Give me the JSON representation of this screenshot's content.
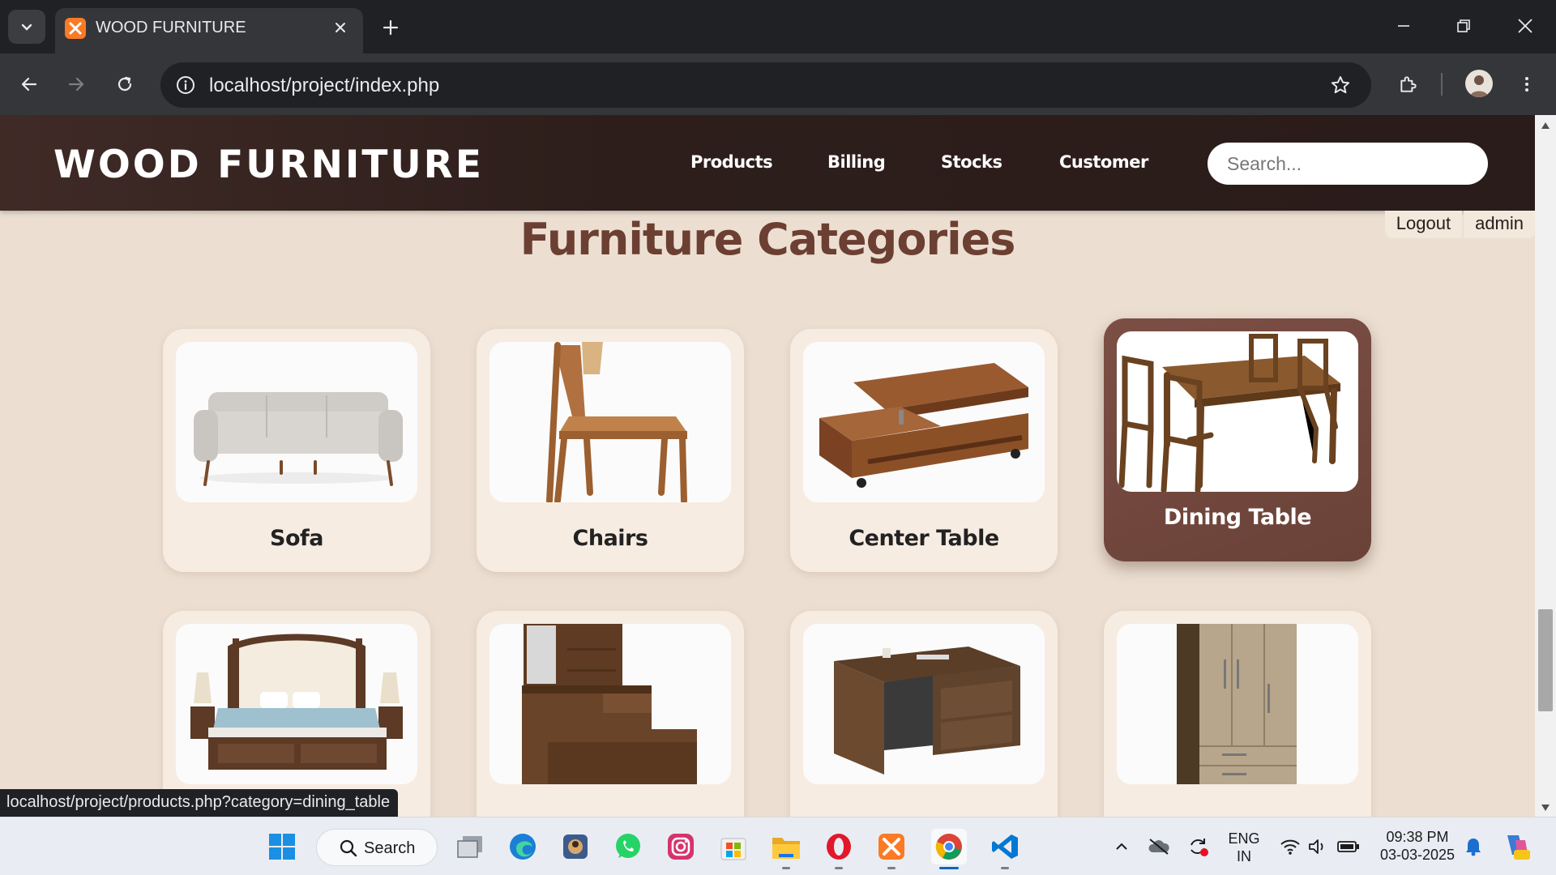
{
  "browser": {
    "tab_title": "WOOD FURNITURE",
    "url": "localhost/project/index.php",
    "status_url": "localhost/project/products.php?category=dining_table"
  },
  "site": {
    "brand": "WOOD FURNITURE",
    "nav": [
      "Products",
      "Billing",
      "Stocks",
      "Customer"
    ],
    "search_placeholder": "Search...",
    "logout_label": "Logout",
    "username": "admin",
    "page_title": "Furniture Categories",
    "categories": [
      {
        "label": "Sofa",
        "icon": "sofa-image"
      },
      {
        "label": "Chairs",
        "icon": "chair-image"
      },
      {
        "label": "Center Table",
        "icon": "center-table-image"
      },
      {
        "label": "Dining Table",
        "icon": "dining-table-image",
        "hovered": true
      },
      {
        "label": "",
        "icon": "bed-image"
      },
      {
        "label": "",
        "icon": "dressing-table-image"
      },
      {
        "label": "",
        "icon": "writing-table-image"
      },
      {
        "label": "",
        "icon": "wardrobe-image"
      }
    ]
  },
  "taskbar": {
    "search_label": "Search",
    "language": "ENG",
    "region": "IN",
    "time": "09:38 PM",
    "date": "03-03-2025"
  },
  "colors": {
    "header_bg": "#2d1e1b",
    "page_bg": "#ecdfd2",
    "card_bg": "#f7ece2",
    "active_card_bg": "#7c4f45",
    "title_color": "#6b3f32"
  }
}
